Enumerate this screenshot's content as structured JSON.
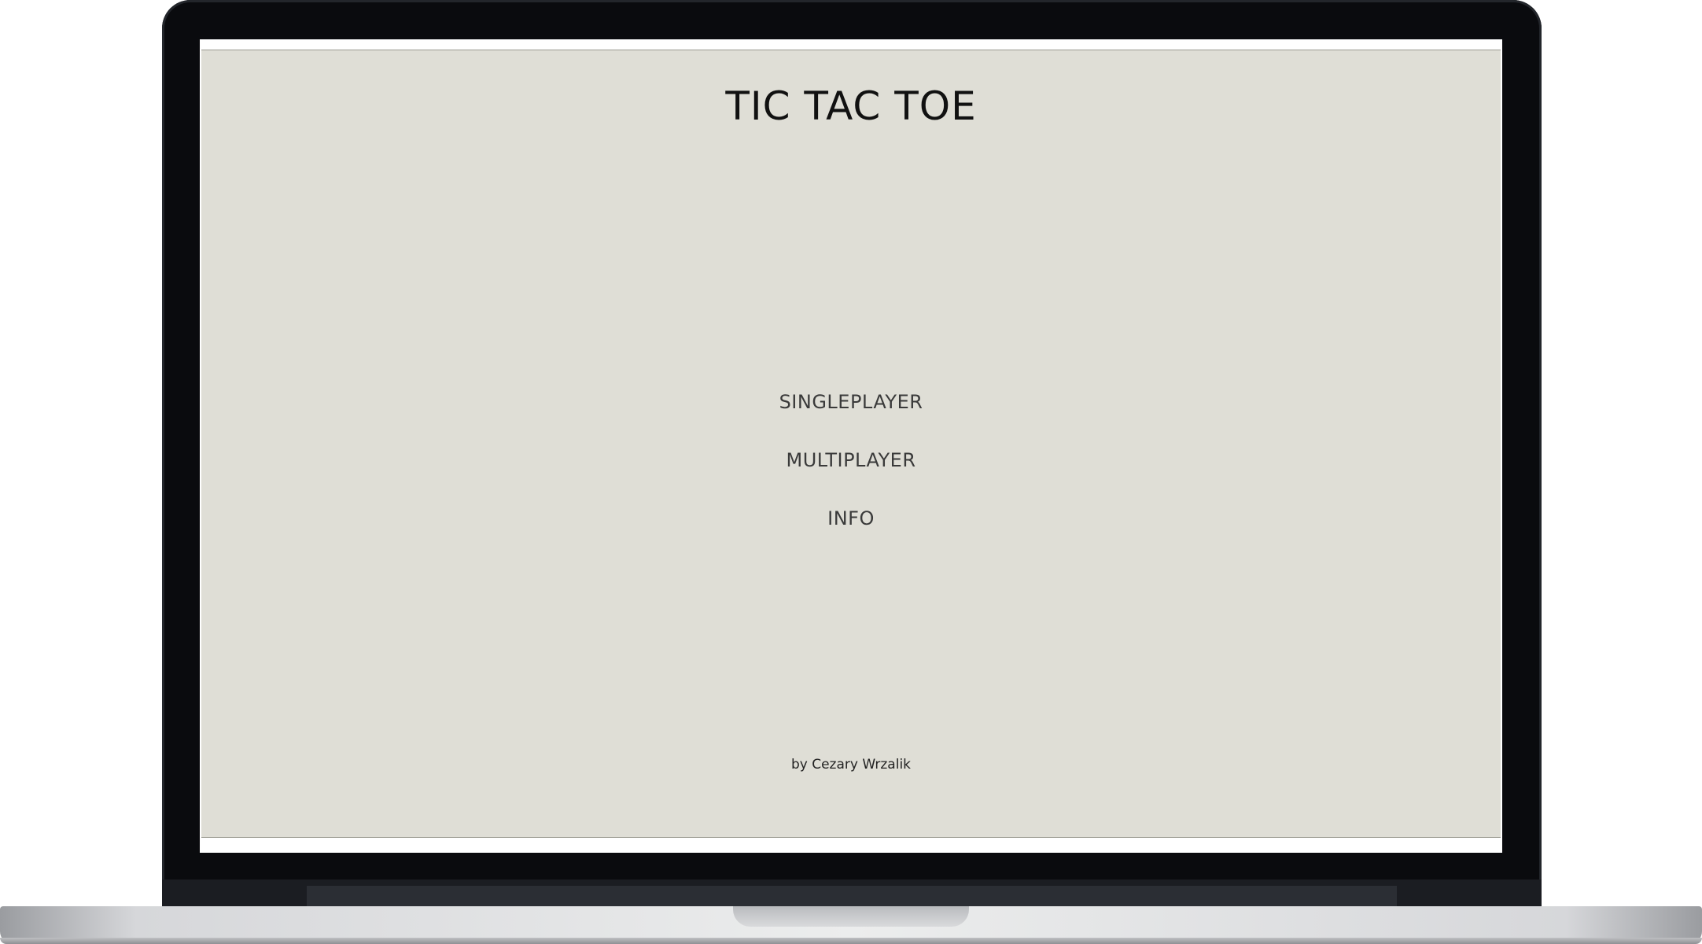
{
  "app": {
    "title": "TIC TAC TOE",
    "menu": [
      {
        "label": "SINGLEPLAYER"
      },
      {
        "label": "MULTIPLAYER"
      },
      {
        "label": "INFO"
      }
    ],
    "footer": "by Cezary Wrzalik"
  },
  "colors": {
    "screen_background": "#dfded6",
    "title_text": "#111111",
    "menu_text": "#3a3a3a",
    "laptop_bezel": "#0a0b0e",
    "laptop_base": "#d6d7da"
  }
}
